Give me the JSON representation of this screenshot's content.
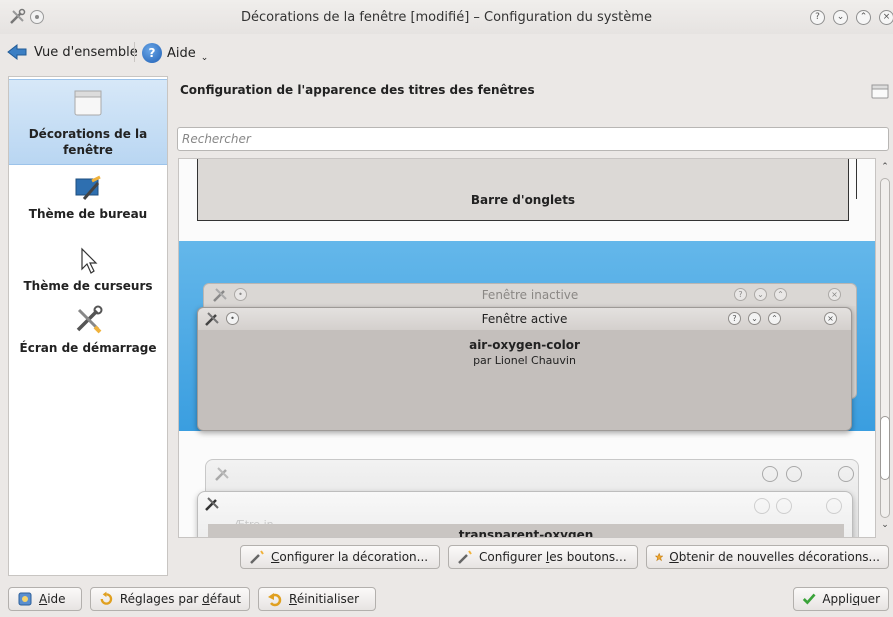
{
  "window": {
    "title": "Décorations de la fenêtre [modifié] – Configuration du système",
    "buttons": [
      "?",
      "⌄",
      "⌃",
      "×"
    ]
  },
  "toolbar": {
    "overview_label": "Vue d'ensemble",
    "help_label": "Aide"
  },
  "sidebar": {
    "items": [
      {
        "label": "Décorations de la fenêtre",
        "icon": "window-decoration-icon",
        "selected": true
      },
      {
        "label": "Thème de bureau",
        "icon": "desktop-theme-icon",
        "selected": false
      },
      {
        "label": "Thème de curseurs",
        "icon": "cursor-icon",
        "selected": false
      },
      {
        "label": "Écran de démarrage",
        "icon": "splash-tools-icon",
        "selected": false
      }
    ]
  },
  "main": {
    "page_title": "Configuration de l'apparence des titres des fenêtres",
    "search_placeholder": "Rechercher",
    "tabbar_label": "Barre d'onglets",
    "preview": {
      "inactive_title": "Fenêtre inactive",
      "active_title": "Fenêtre active",
      "theme_name": "air-oxygen-color",
      "theme_author": "par Lionel Chauvin",
      "second_theme_name": "transparent-oxygen",
      "second_inner_title": "Ætre in..."
    }
  },
  "actions": {
    "configure_decoration_prefix": "",
    "configure_decoration_u": "C",
    "configure_decoration_rest": "onfigurer la décoration...",
    "configure_buttons_prefix": "Configurer ",
    "configure_buttons_u": "l",
    "configure_buttons_rest": "es boutons...",
    "get_new_u": "O",
    "get_new_rest": "btenir de nouvelles décorations..."
  },
  "bottom": {
    "help_u": "A",
    "help_rest": "ide",
    "defaults_prefix": "Réglages par ",
    "defaults_u": "d",
    "defaults_rest": "éfaut",
    "reset_u": "R",
    "reset_rest": "éinitialiser",
    "apply_prefix": "Appli",
    "apply_u": "q",
    "apply_rest": "uer"
  },
  "colors": {
    "selection_blue": "#3a9ee0",
    "sidebar_selected": "#b9d6f2"
  }
}
